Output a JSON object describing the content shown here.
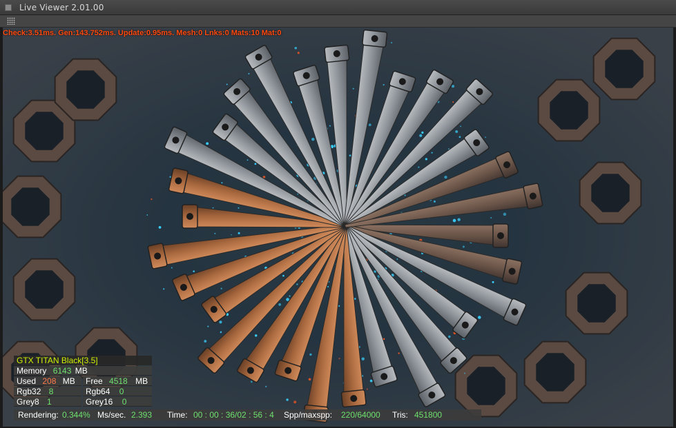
{
  "window": {
    "title": "Live Viewer 2.01.00"
  },
  "overlay": {
    "stats": "Check:3.51ms. Gen:143.752ms. Update:0.95ms. Mesh:0 Lnks:0 Mats:10 Mat:0",
    "gpu_name": "GTX TITAN Black[3.5]",
    "memory_label": "Memory",
    "memory_value": "6143",
    "memory_unit": "MB",
    "used_label": "Used",
    "used_value": "208",
    "used_unit": "MB",
    "free_label": "Free",
    "free_value": "4518",
    "free_unit": "MB",
    "rgb32_label": "Rgb32",
    "rgb32_value": "8",
    "rgb64_label": "Rgb64",
    "rgb64_value": "0",
    "grey8_label": "Grey8",
    "grey8_value": "1",
    "grey16_label": "Grey16",
    "grey16_value": "0"
  },
  "status": {
    "rendering_label": "Rendering:",
    "rendering_value": "0.344%",
    "mssec_label": "Ms/sec.",
    "mssec_value": "2.393",
    "time_label": "Time:",
    "time_value": "00 : 00 : 36/02 : 56 : 4",
    "spp_label": "Spp/maxspp:",
    "spp_value": "220/64000",
    "tris_label": "Tris:",
    "tris_value": "451800"
  },
  "colors": {
    "stats": "#ff4a10",
    "value": "#6ee06e",
    "gpu": "#d0f000"
  }
}
